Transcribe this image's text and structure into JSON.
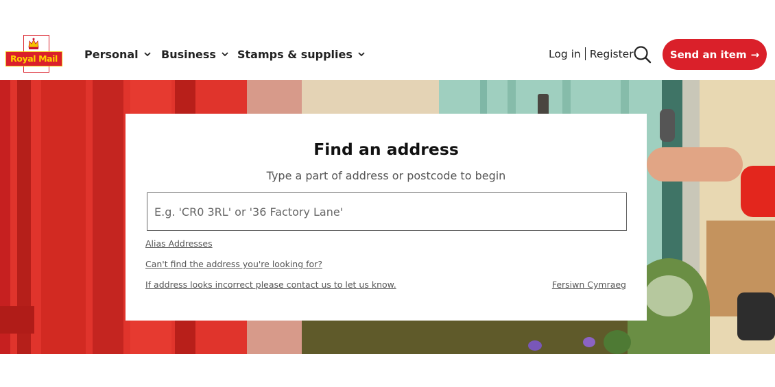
{
  "brand": {
    "logo_text": "Royal Mail",
    "red": "#da202a",
    "yellow": "#ffd200"
  },
  "nav": [
    {
      "label": "Personal"
    },
    {
      "label": "Business"
    },
    {
      "label": "Stamps & supplies"
    }
  ],
  "auth": {
    "login": "Log in",
    "register": "Register"
  },
  "search": {
    "icon": "search-icon"
  },
  "cta": {
    "label": "Send an item",
    "arrow": "→"
  },
  "finder": {
    "title": "Find an address",
    "subtitle": "Type a part of address or postcode to begin",
    "placeholder": "E.g. 'CR0 3RL' or '36 Factory Lane'",
    "links": {
      "alias": "Alias Addresses",
      "cant_find": "Can't find the address you're looking for?",
      "incorrect": "If address looks incorrect please contact us to let us know.",
      "welsh": "Fersiwn Cymraeg"
    }
  }
}
